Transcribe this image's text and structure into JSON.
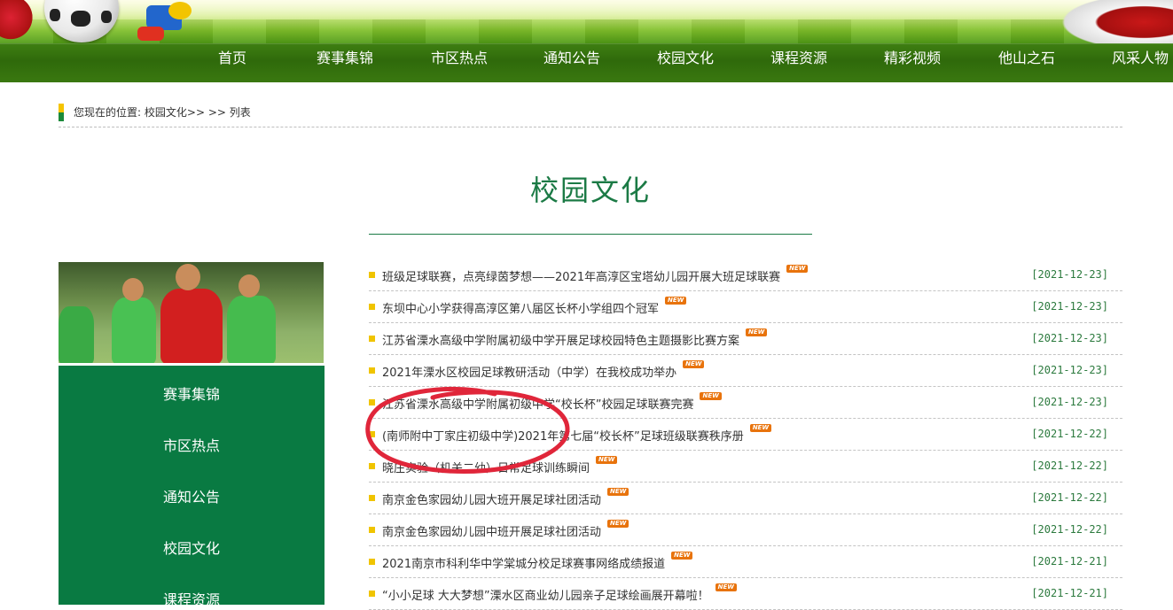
{
  "nav": {
    "items": [
      "首页",
      "赛事集锦",
      "市区热点",
      "通知公告",
      "校园文化",
      "课程资源",
      "精彩视频",
      "他山之石",
      "风采人物"
    ]
  },
  "breadcrumb": {
    "prefix": "您现在的位置:",
    "section": "校园文化",
    "sep1": ">>",
    "sep2": ">>",
    "current": "列表"
  },
  "section_title": "校园文化",
  "sidebar": {
    "items": [
      "赛事集锦",
      "市区热点",
      "通知公告",
      "校园文化",
      "课程资源"
    ]
  },
  "badge_text": "NEW",
  "articles": [
    {
      "title": "班级足球联赛，点亮绿茵梦想——2021年高淳区宝塔幼儿园开展大班足球联赛",
      "date": "[2021-12-23]"
    },
    {
      "title": "东坝中心小学获得高淳区第八届区长杯小学组四个冠军",
      "date": "[2021-12-23]"
    },
    {
      "title": "江苏省溧水高级中学附属初级中学开展足球校园特色主题摄影比赛方案",
      "date": "[2021-12-23]"
    },
    {
      "title": "2021年溧水区校园足球教研活动（中学）在我校成功举办",
      "date": "[2021-12-23]"
    },
    {
      "title": "江苏省溧水高级中学附属初级中学“校长杯”校园足球联赛完赛",
      "date": "[2021-12-23]"
    },
    {
      "title": "(南师附中丁家庄初级中学)2021年第七届“校长杯”足球班级联赛秩序册",
      "date": "[2021-12-22]"
    },
    {
      "title": "晓庄实验（机关二幼）日常足球训练瞬间",
      "date": "[2021-12-22]"
    },
    {
      "title": "南京金色家园幼儿园大班开展足球社团活动",
      "date": "[2021-12-22]"
    },
    {
      "title": "南京金色家园幼儿园中班开展足球社团活动",
      "date": "[2021-12-22]"
    },
    {
      "title": "2021南京市科利华中学棠城分校足球赛事网络成绩报道",
      "date": "[2021-12-21]"
    },
    {
      "title": "“小小足球 大大梦想”溧水区商业幼儿园亲子足球绘画展开幕啦！",
      "date": "[2021-12-21]"
    }
  ],
  "colors": {
    "nav_green": "#2f6a0b",
    "sidebar_green": "#097a42",
    "title_green": "#1b7a45",
    "bullet_yellow": "#f0c400",
    "date_green": "#2c7a3e",
    "badge_orange": "#e8730c",
    "annotation_red": "#e0263a"
  }
}
